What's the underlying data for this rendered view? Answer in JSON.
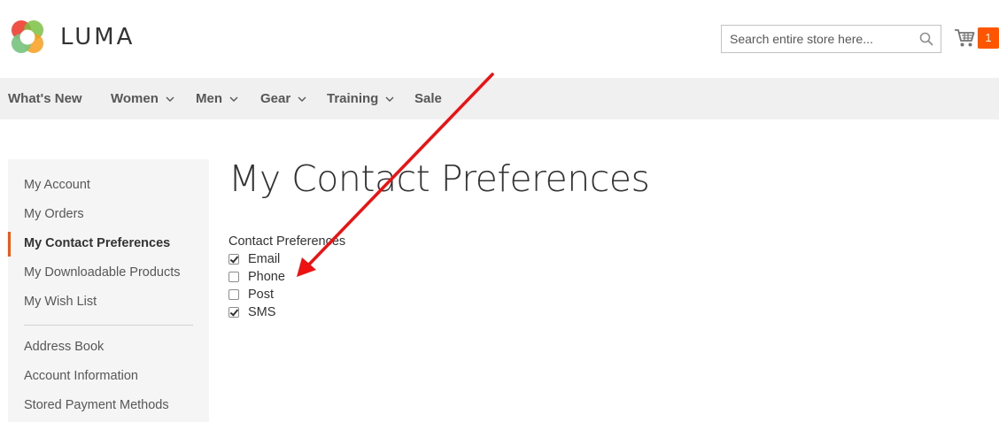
{
  "header": {
    "logo_text": "LUMA",
    "search_placeholder": "Search entire store here...",
    "cart_count": "1"
  },
  "nav": {
    "items": [
      {
        "label": "What's New",
        "has_dropdown": false
      },
      {
        "label": "Women",
        "has_dropdown": true
      },
      {
        "label": "Men",
        "has_dropdown": true
      },
      {
        "label": "Gear",
        "has_dropdown": true
      },
      {
        "label": "Training",
        "has_dropdown": true
      },
      {
        "label": "Sale",
        "has_dropdown": false
      }
    ]
  },
  "sidebar": {
    "items": [
      {
        "label": "My Account"
      },
      {
        "label": "My Orders"
      },
      {
        "label": "My Contact Preferences",
        "active": true
      },
      {
        "label": "My Downloadable Products"
      },
      {
        "label": "My Wish List"
      },
      {
        "label": "Address Book"
      },
      {
        "label": "Account Information"
      },
      {
        "label": "Stored Payment Methods"
      }
    ]
  },
  "main": {
    "title": "My Contact Preferences",
    "prefs_label": "Contact Preferences",
    "options": [
      {
        "label": "Email",
        "checked": true
      },
      {
        "label": "Phone",
        "checked": false
      },
      {
        "label": "Post",
        "checked": false
      },
      {
        "label": "SMS",
        "checked": true
      }
    ]
  },
  "colors": {
    "accent": "#ff5501",
    "nav_bg": "#f0f0f0",
    "sidebar_bg": "#f5f5f5",
    "annotation_arrow": "#ee1111"
  },
  "icons": [
    "luma-logo-icon",
    "search-icon",
    "cart-icon",
    "chevron-down-icon",
    "checkbox-icon",
    "annotation-arrow-icon"
  ]
}
